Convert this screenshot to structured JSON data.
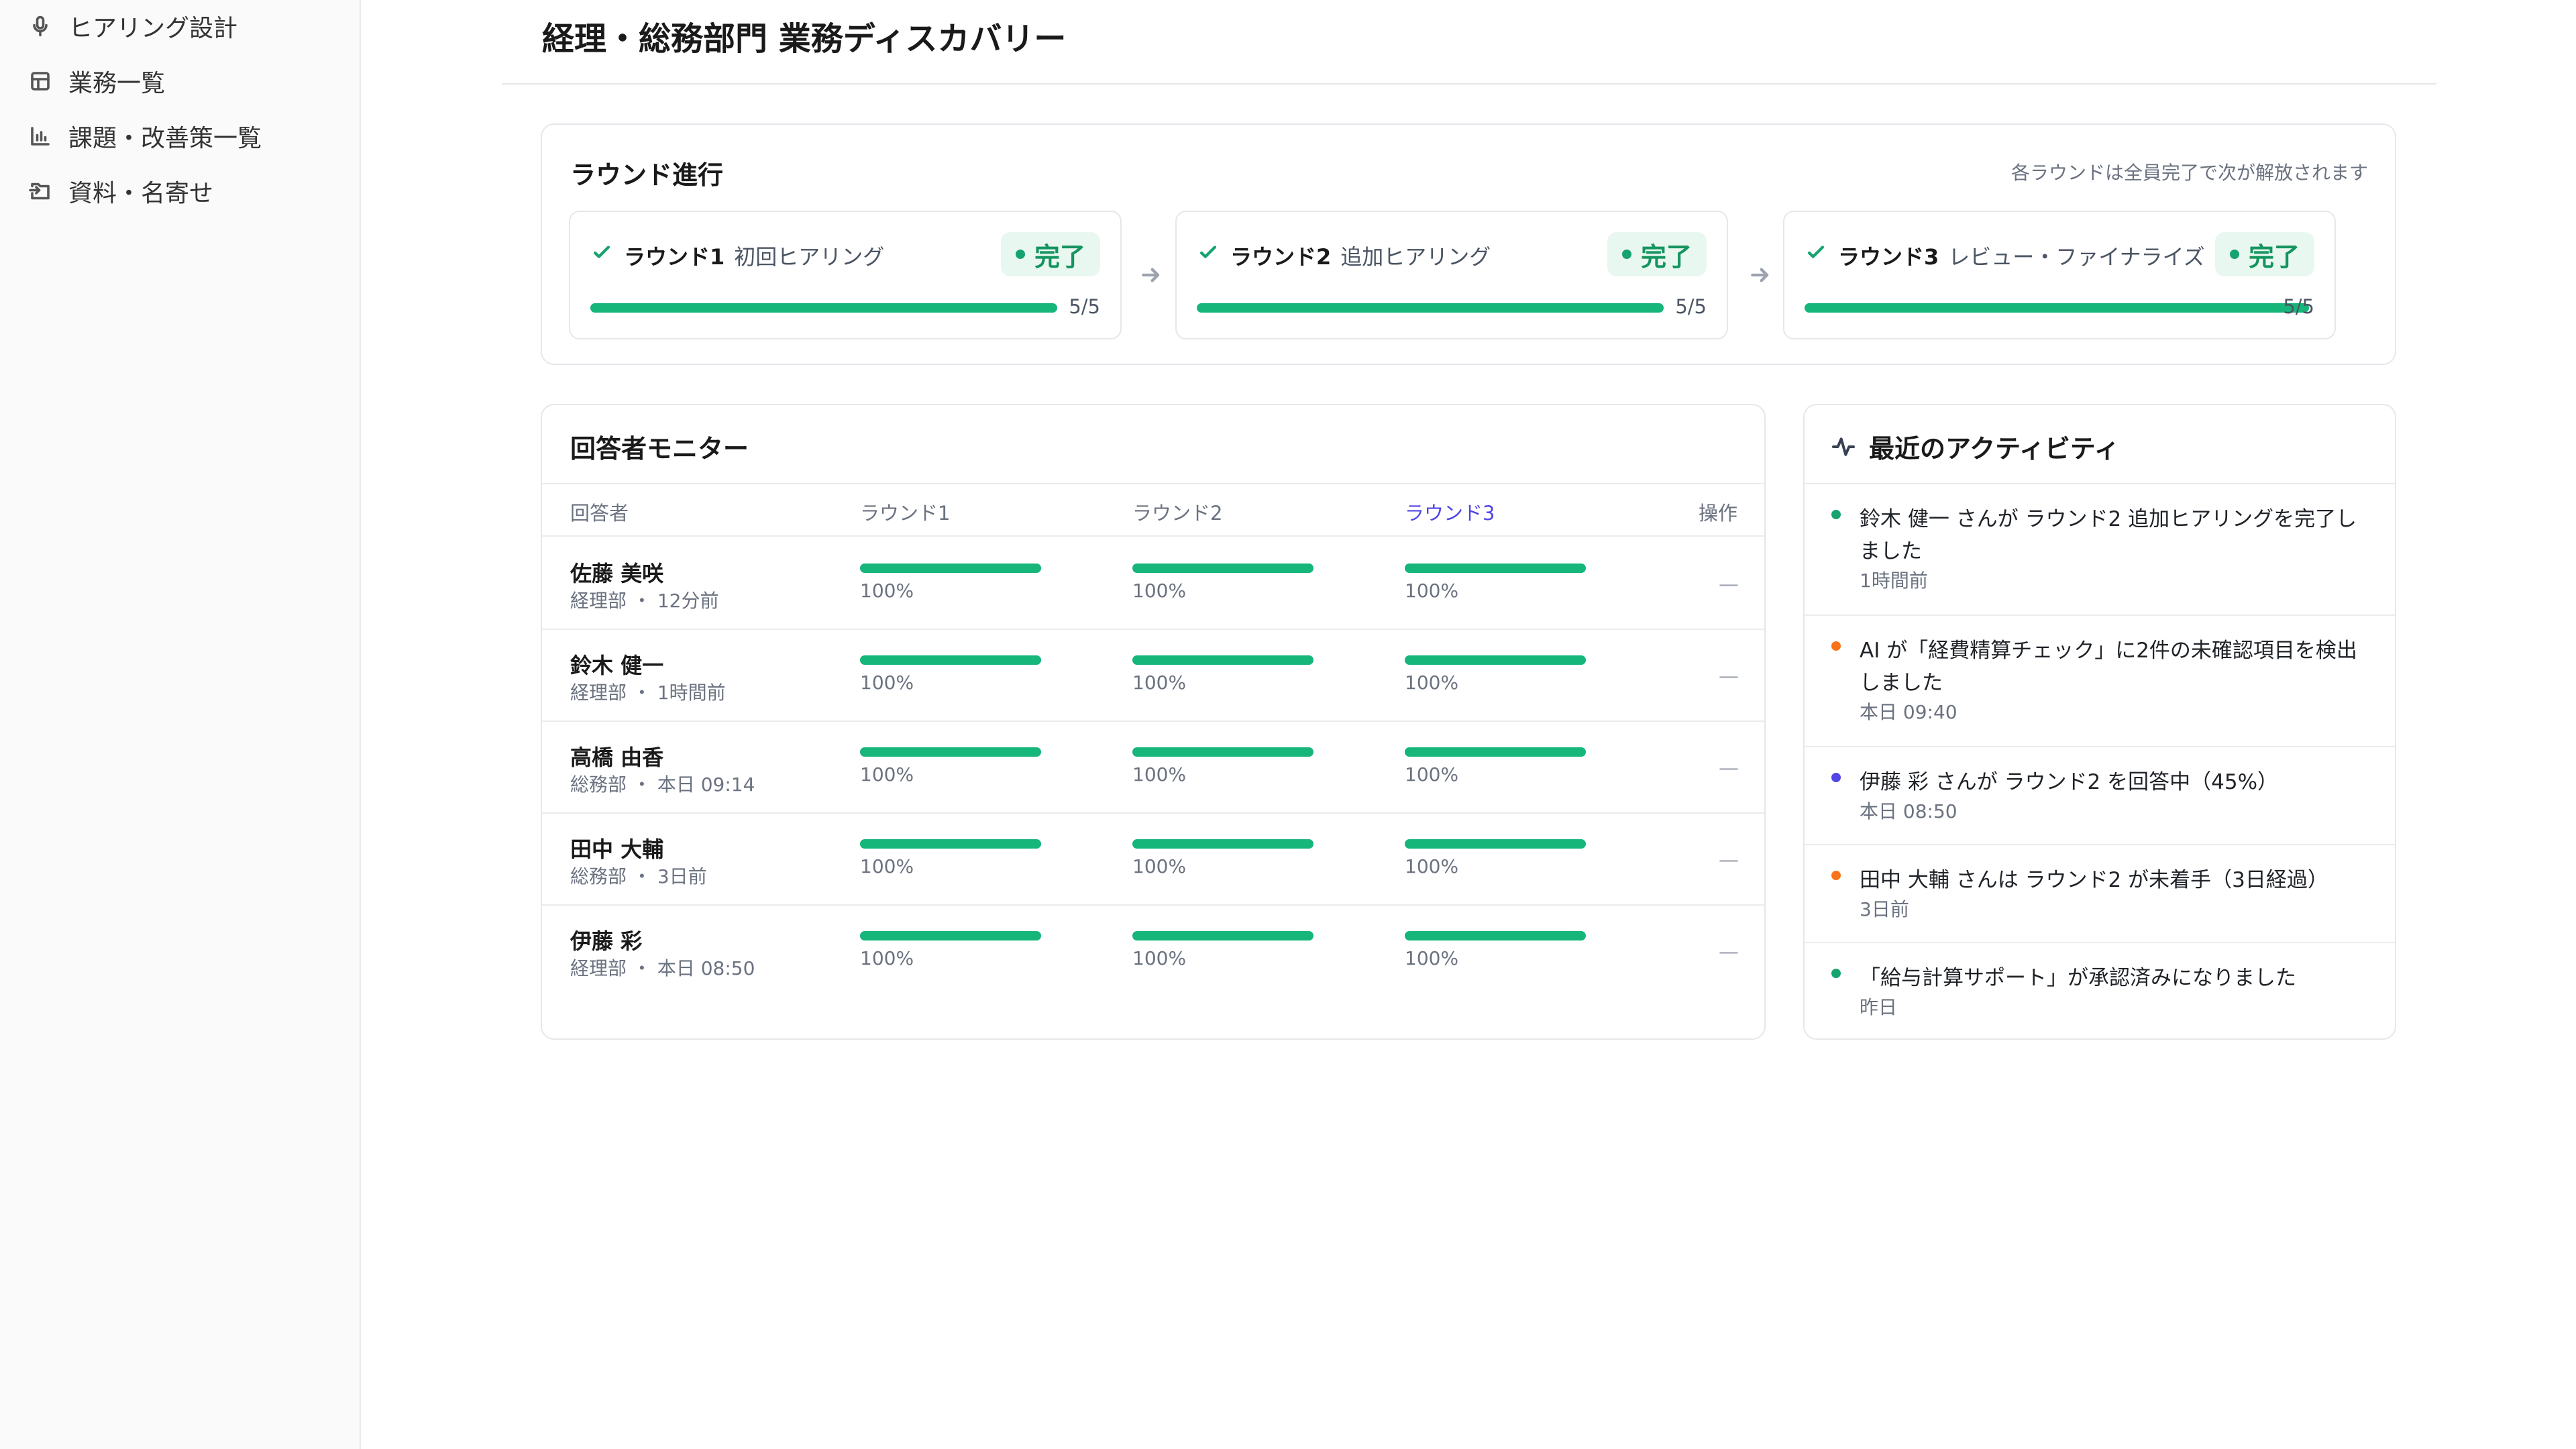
{
  "sidebar": {
    "items": [
      {
        "label": "ヒアリング設計",
        "icon": "microphone-icon"
      },
      {
        "label": "業務一覧",
        "icon": "table-icon"
      },
      {
        "label": "課題・改善策一覧",
        "icon": "bar-chart-icon"
      },
      {
        "label": "資料・名寄せ",
        "icon": "folder-import-icon"
      }
    ]
  },
  "header": {
    "title": "経理・総務部門 業務ディスカバリー"
  },
  "rounds": {
    "title": "ラウンド進行",
    "note": "各ラウンドは全員完了で次が解放されます",
    "items": [
      {
        "name": "ラウンド1",
        "subtitle": "初回ヒアリング",
        "status": "完了",
        "progress": 1.0,
        "count": "5/5"
      },
      {
        "name": "ラウンド2",
        "subtitle": "追加ヒアリング",
        "status": "完了",
        "progress": 1.0,
        "count": "5/5"
      },
      {
        "name": "ラウンド3",
        "subtitle": "レビュー・ファイナライズ",
        "status": "完了",
        "progress": 1.0,
        "count": "5/5"
      }
    ]
  },
  "monitor": {
    "title": "回答者モニター",
    "columns": [
      "回答者",
      "ラウンド1",
      "ラウンド2",
      "ラウンド3",
      "操作"
    ],
    "active_column": "ラウンド3",
    "rows": [
      {
        "name": "佐藤 美咲",
        "dept": "経理部",
        "time": "12分前",
        "r1": "100%",
        "r2": "100%",
        "r3": "100%",
        "op": "—"
      },
      {
        "name": "鈴木 健一",
        "dept": "経理部",
        "time": "1時間前",
        "r1": "100%",
        "r2": "100%",
        "r3": "100%",
        "op": "—"
      },
      {
        "name": "高橋 由香",
        "dept": "総務部",
        "time": "本日 09:14",
        "r1": "100%",
        "r2": "100%",
        "r3": "100%",
        "op": "—"
      },
      {
        "name": "田中 大輔",
        "dept": "総務部",
        "time": "3日前",
        "r1": "100%",
        "r2": "100%",
        "r3": "100%",
        "op": "—"
      },
      {
        "name": "伊藤 彩",
        "dept": "経理部",
        "time": "本日 08:50",
        "r1": "100%",
        "r2": "100%",
        "r3": "100%",
        "op": "—"
      }
    ],
    "separator": "・"
  },
  "activity": {
    "title": "最近のアクティビティ",
    "items": [
      {
        "text": "鈴木 健一 さんが ラウンド2 追加ヒアリングを完了しました",
        "time": "1時間前",
        "color": "#16a36f"
      },
      {
        "text": "AI が「経費精算チェック」に2件の未確認項目を検出しました",
        "time": "本日 09:40",
        "color": "#f97316"
      },
      {
        "text": "伊藤 彩 さんが ラウンド2 を回答中（45%）",
        "time": "本日 08:50",
        "color": "#4f46e5"
      },
      {
        "text": "田中 大輔 さんは ラウンド2 が未着手（3日経過）",
        "time": "3日前",
        "color": "#f97316"
      },
      {
        "text": "「給与計算サポート」が承認済みになりました",
        "time": "昨日",
        "color": "#16a36f"
      }
    ]
  },
  "colors": {
    "accent": "#4f46e5",
    "success": "#16b67a",
    "success_badge_bg": "#e8f7ef"
  }
}
